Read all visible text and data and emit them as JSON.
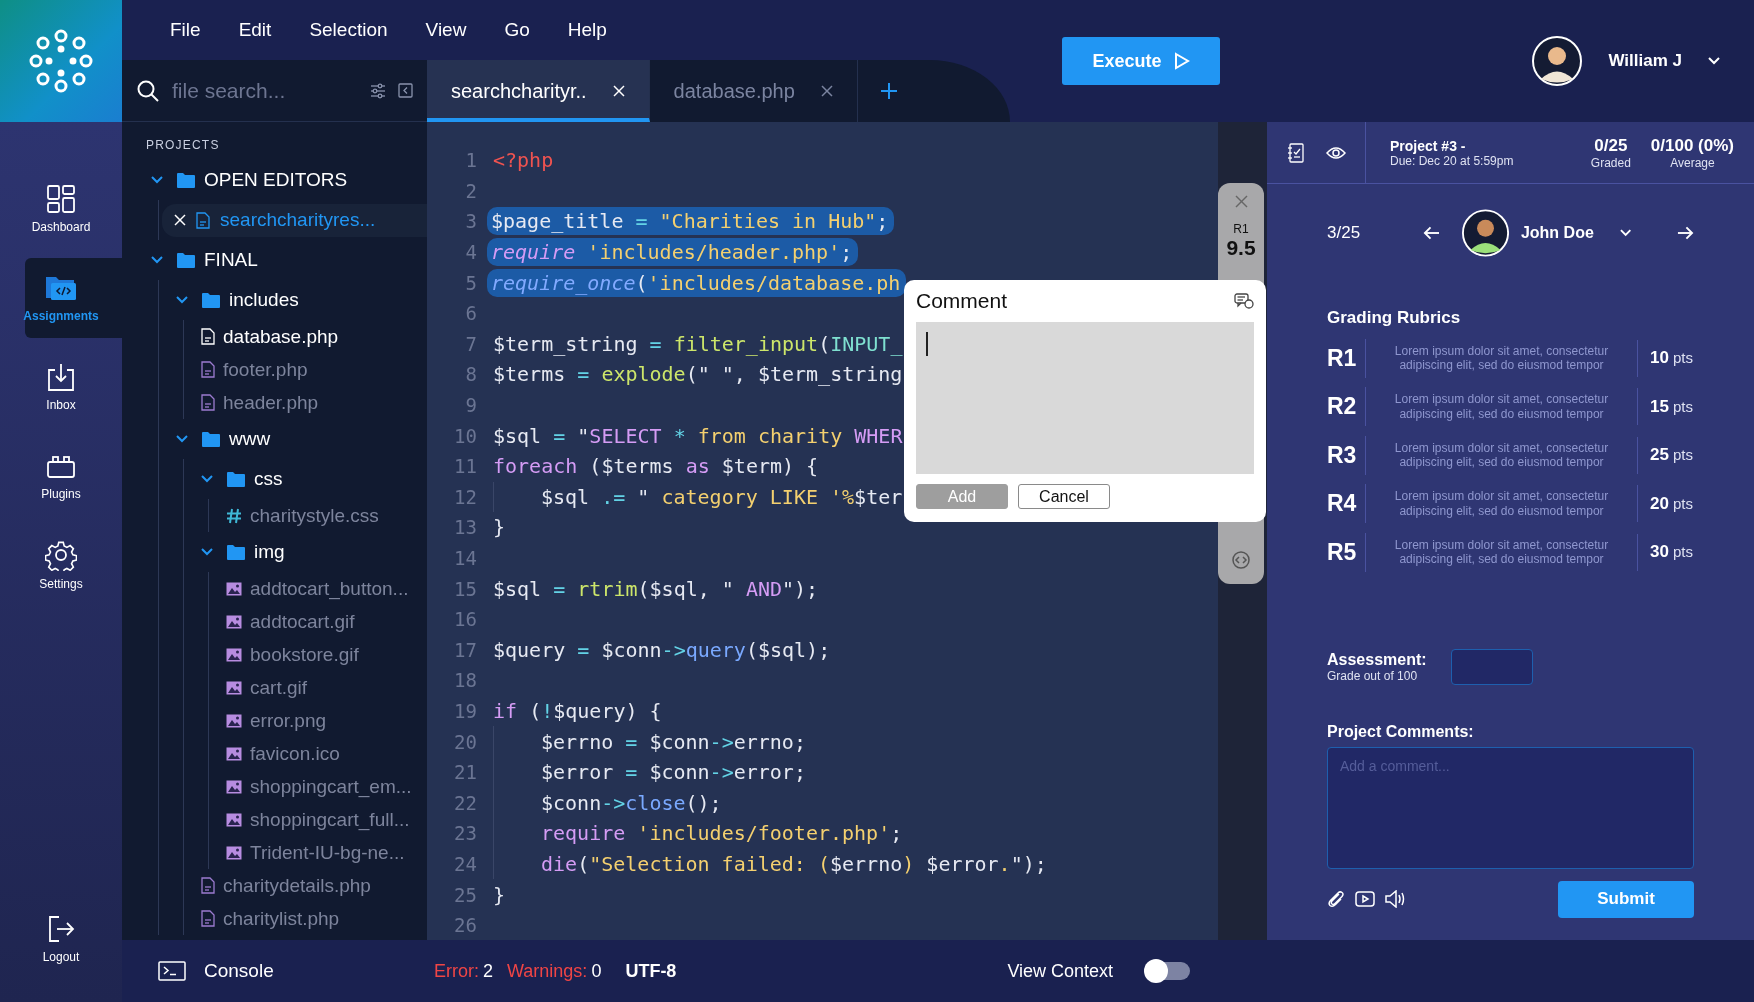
{
  "menu": [
    "File",
    "Edit",
    "Selection",
    "View",
    "Go",
    "Help"
  ],
  "file_search": {
    "placeholder": "file search..."
  },
  "tabs": [
    {
      "label": "searchcharityr..",
      "selected": true
    },
    {
      "label": "database.php",
      "selected": false
    }
  ],
  "execute_button": "Execute",
  "user": {
    "name": "William J"
  },
  "nav": [
    {
      "label": "Dashboard",
      "kind": "dashboard",
      "selected": false
    },
    {
      "label": "Assignments",
      "kind": "assignments",
      "selected": true
    },
    {
      "label": "Inbox",
      "kind": "inbox",
      "selected": false
    },
    {
      "label": "Plugins",
      "kind": "plugins",
      "selected": false
    },
    {
      "label": "Settings",
      "kind": "settings",
      "selected": false
    }
  ],
  "logout": "Logout",
  "explorer": {
    "title": "PROJECTS",
    "tree": [
      {
        "name": "OPEN EDITORS",
        "kind": "folder",
        "expanded": true,
        "children": [
          {
            "name": "searchcharityres...",
            "kind": "editor",
            "selected": true
          }
        ]
      },
      {
        "name": "FINAL",
        "kind": "folder",
        "expanded": true,
        "children": [
          {
            "name": "includes",
            "kind": "folder",
            "expanded": true,
            "children": [
              {
                "name": "database.php",
                "kind": "php",
                "selected": false,
                "dimmed": false
              },
              {
                "name": "footer.php",
                "kind": "php",
                "selected": false,
                "dimmed": true
              },
              {
                "name": "header.php",
                "kind": "php",
                "selected": false,
                "dimmed": true
              }
            ]
          },
          {
            "name": "www",
            "kind": "folder",
            "expanded": true,
            "children": [
              {
                "name": "css",
                "kind": "folder",
                "expanded": true,
                "children": [
                  {
                    "name": "charitystyle.css",
                    "kind": "css",
                    "selected": false,
                    "dimmed": true
                  }
                ]
              },
              {
                "name": "img",
                "kind": "folder",
                "expanded": true,
                "children": [
                  {
                    "name": "addtocart_button...",
                    "kind": "image",
                    "selected": false,
                    "dimmed": true
                  },
                  {
                    "name": "addtocart.gif",
                    "kind": "image",
                    "selected": false,
                    "dimmed": true
                  },
                  {
                    "name": "bookstore.gif",
                    "kind": "image",
                    "selected": false,
                    "dimmed": true
                  },
                  {
                    "name": "cart.gif",
                    "kind": "image",
                    "selected": false,
                    "dimmed": true
                  },
                  {
                    "name": "error.png",
                    "kind": "image",
                    "selected": false,
                    "dimmed": true
                  },
                  {
                    "name": "favicon.ico",
                    "kind": "image",
                    "selected": false,
                    "dimmed": true
                  },
                  {
                    "name": "shoppingcart_em...",
                    "kind": "image",
                    "selected": false,
                    "dimmed": true
                  },
                  {
                    "name": "shoppingcart_full...",
                    "kind": "image",
                    "selected": false,
                    "dimmed": true
                  },
                  {
                    "name": "Trident-IU-bg-ne...",
                    "kind": "image",
                    "selected": false,
                    "dimmed": true
                  }
                ]
              },
              {
                "name": "charitydetails.php",
                "kind": "php",
                "selected": false,
                "dimmed": true
              },
              {
                "name": "charitylist.php",
                "kind": "php",
                "selected": false,
                "dimmed": true
              }
            ]
          }
        ]
      }
    ]
  },
  "code": {
    "lines": [
      {
        "number": "1",
        "selected": false,
        "indented": false,
        "tokens": [
          {
            "text": "<?php",
            "kind": "tag"
          }
        ]
      },
      {
        "number": "2",
        "selected": false,
        "indented": false
      },
      {
        "number": "3",
        "selected": true,
        "indented": false,
        "tokens": [
          {
            "text": "$page_title",
            "kind": "var"
          },
          {
            "text": " = ",
            "kind": "op"
          },
          {
            "text": "\"Charities in Hub\"",
            "kind": "str"
          },
          {
            "text": ";",
            "kind": "var"
          }
        ]
      },
      {
        "number": "4",
        "selected": true,
        "indented": false,
        "tokens": [
          {
            "text": "require",
            "kind": "kwi"
          },
          {
            "text": " 'includes/header.php'",
            "kind": "str"
          },
          {
            "text": ";",
            "kind": "var"
          }
        ]
      },
      {
        "number": "5",
        "selected": true,
        "indented": false,
        "tokens": [
          {
            "text": "require_once",
            "kind": "fni"
          },
          {
            "text": "(",
            "kind": "var"
          },
          {
            "text": "'includes/database.ph",
            "kind": "str"
          }
        ]
      },
      {
        "number": "6",
        "selected": false,
        "indented": false
      },
      {
        "number": "7",
        "selected": false,
        "indented": false,
        "tokens": [
          {
            "text": "$term_string",
            "kind": "var"
          },
          {
            "text": " = ",
            "kind": "op"
          },
          {
            "text": "filter_input",
            "kind": "fn"
          },
          {
            "text": "(",
            "kind": "var"
          },
          {
            "text": "INPUT_",
            "kind": "const"
          }
        ]
      },
      {
        "number": "8",
        "selected": false,
        "indented": false,
        "tokens": [
          {
            "text": "$terms",
            "kind": "var"
          },
          {
            "text": " = ",
            "kind": "op"
          },
          {
            "text": "explode",
            "kind": "fn"
          },
          {
            "text": "(\" \", $term_string",
            "kind": "var"
          }
        ]
      },
      {
        "number": "9",
        "selected": false,
        "indented": false
      },
      {
        "number": "10",
        "selected": false,
        "indented": false,
        "tokens": [
          {
            "text": "$sql",
            "kind": "var"
          },
          {
            "text": " = ",
            "kind": "op"
          },
          {
            "text": "\"",
            "kind": "var"
          },
          {
            "text": "SELECT",
            "kind": "kw"
          },
          {
            "text": " * ",
            "kind": "op"
          },
          {
            "text": "from charity ",
            "kind": "str"
          },
          {
            "text": "WHER",
            "kind": "kw"
          }
        ]
      },
      {
        "number": "11",
        "selected": false,
        "indented": false,
        "tokens": [
          {
            "text": "foreach",
            "kind": "kw"
          },
          {
            "text": " ($terms ",
            "kind": "var"
          },
          {
            "text": "as",
            "kind": "kw"
          },
          {
            "text": " $term) {",
            "kind": "var"
          }
        ]
      },
      {
        "number": "12",
        "selected": false,
        "indented": true,
        "tokens": [
          {
            "text": "$sql",
            "kind": "var"
          },
          {
            "text": " .= ",
            "kind": "op"
          },
          {
            "text": "\" ",
            "kind": "var"
          },
          {
            "text": "category LIKE '%",
            "kind": "str"
          },
          {
            "text": "$ter",
            "kind": "var"
          }
        ]
      },
      {
        "number": "13",
        "selected": false,
        "indented": false,
        "tokens": [
          {
            "text": "}",
            "kind": "var"
          }
        ]
      },
      {
        "number": "14",
        "selected": false,
        "indented": false
      },
      {
        "number": "15",
        "selected": false,
        "indented": false,
        "tokens": [
          {
            "text": "$sql",
            "kind": "var"
          },
          {
            "text": " = ",
            "kind": "op"
          },
          {
            "text": "rtrim",
            "kind": "fn"
          },
          {
            "text": "($sql, \" ",
            "kind": "var"
          },
          {
            "text": "AND",
            "kind": "kw"
          },
          {
            "text": "\");",
            "kind": "var"
          }
        ]
      },
      {
        "number": "16",
        "selected": false,
        "indented": false
      },
      {
        "number": "17",
        "selected": false,
        "indented": false,
        "tokens": [
          {
            "text": "$query",
            "kind": "var"
          },
          {
            "text": " = ",
            "kind": "op"
          },
          {
            "text": "$conn",
            "kind": "var"
          },
          {
            "text": "->",
            "kind": "op"
          },
          {
            "text": "query",
            "kind": "method"
          },
          {
            "text": "($sql);",
            "kind": "var"
          }
        ]
      },
      {
        "number": "18",
        "selected": false,
        "indented": false
      },
      {
        "number": "19",
        "selected": false,
        "indented": false,
        "tokens": [
          {
            "text": "if",
            "kind": "kw"
          },
          {
            "text": " (",
            "kind": "var"
          },
          {
            "text": "!",
            "kind": "op"
          },
          {
            "text": "$query) {",
            "kind": "var"
          }
        ]
      },
      {
        "number": "20",
        "selected": false,
        "indented": true,
        "tokens": [
          {
            "text": "$errno",
            "kind": "var"
          },
          {
            "text": " = ",
            "kind": "op"
          },
          {
            "text": "$conn",
            "kind": "var"
          },
          {
            "text": "->",
            "kind": "op"
          },
          {
            "text": "errno;",
            "kind": "var"
          }
        ]
      },
      {
        "number": "21",
        "selected": false,
        "indented": true,
        "tokens": [
          {
            "text": "$error",
            "kind": "var"
          },
          {
            "text": " = ",
            "kind": "op"
          },
          {
            "text": "$conn",
            "kind": "var"
          },
          {
            "text": "->",
            "kind": "op"
          },
          {
            "text": "error;",
            "kind": "var"
          }
        ]
      },
      {
        "number": "22",
        "selected": false,
        "indented": true,
        "tokens": [
          {
            "text": "$conn",
            "kind": "var"
          },
          {
            "text": "->",
            "kind": "op"
          },
          {
            "text": "close",
            "kind": "method"
          },
          {
            "text": "();",
            "kind": "var"
          }
        ]
      },
      {
        "number": "23",
        "selected": false,
        "indented": true,
        "tokens": [
          {
            "text": "require",
            "kind": "kw"
          },
          {
            "text": " 'includes/footer.php'",
            "kind": "str"
          },
          {
            "text": ";",
            "kind": "var"
          }
        ]
      },
      {
        "number": "24",
        "selected": false,
        "indented": true,
        "tokens": [
          {
            "text": "die",
            "kind": "kw"
          },
          {
            "text": "(",
            "kind": "var"
          },
          {
            "text": "\"Selection failed: (",
            "kind": "str"
          },
          {
            "text": "$errno",
            "kind": "var"
          },
          {
            "text": ") ",
            "kind": "str"
          },
          {
            "text": "$error",
            "kind": "var"
          },
          {
            "text": ".",
            "kind": "str"
          },
          {
            "text": "\");",
            "kind": "var"
          }
        ]
      },
      {
        "number": "25",
        "selected": false,
        "indented": false,
        "tokens": [
          {
            "text": "}",
            "kind": "var"
          }
        ]
      },
      {
        "number": "26",
        "selected": false,
        "indented": false
      }
    ]
  },
  "score_strip": {
    "rubric": "R1",
    "score": "9.5"
  },
  "comment_popup": {
    "title": "Comment",
    "add": "Add",
    "add_disabled": true,
    "cancel": "Cancel"
  },
  "grading": {
    "project": "Project #3 -",
    "due": "Due: Dec 20 at 5:59pm",
    "stats": [
      {
        "value": "0/25",
        "label": "Graded"
      },
      {
        "value": "0/100 (0%)",
        "label": "Average"
      }
    ],
    "position": "3/25",
    "student": "John Doe",
    "rubrics_title": "Grading Rubrics",
    "rubrics": [
      {
        "id": "R1",
        "description": "Lorem ipsum dolor sit amet, consectetur adipiscing elit, sed do eiusmod tempor",
        "points": "10",
        "unit": "pts"
      },
      {
        "id": "R2",
        "description": "Lorem ipsum dolor sit amet, consectetur adipiscing elit, sed do eiusmod tempor",
        "points": "15",
        "unit": "pts"
      },
      {
        "id": "R3",
        "description": "Lorem ipsum dolor sit amet, consectetur adipiscing elit, sed do eiusmod tempor",
        "points": "25",
        "unit": "pts"
      },
      {
        "id": "R4",
        "description": "Lorem ipsum dolor sit amet, consectetur adipiscing elit, sed do eiusmod tempor",
        "points": "20",
        "unit": "pts"
      },
      {
        "id": "R5",
        "description": "Lorem ipsum dolor sit amet, consectetur adipiscing elit, sed do eiusmod tempor",
        "points": "30",
        "unit": "pts"
      }
    ],
    "assessment": {
      "label": "Assessment:",
      "hint": "Grade out of 100"
    },
    "comments": {
      "label": "Project Comments:",
      "placeholder": "Add a comment..."
    },
    "submit": "Submit"
  },
  "status_bar": {
    "console": "Console",
    "error_label": "Error:",
    "errors": "2",
    "warning_label": "Warnings:",
    "warnings": "0",
    "encoding": "UTF-8",
    "view_context": {
      "label": "View Context",
      "on": false
    }
  }
}
